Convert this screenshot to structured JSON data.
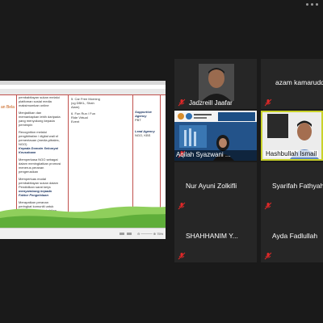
{
  "slide": {
    "header_partial": "an Bela",
    "col2_items": [
      "pembabitayan sukan melalui",
      "platfoman sosial media",
      "maksimumkan online",
      "Menjadikan dan",
      "memantapkan lebih daripada",
      "yang menyokong kepada",
      "pemimpin",
      "Recognition melalui",
      "pengiktirafan / digital wali sf",
      "pementauan (media,pitrales,",
      "NGO)",
      "Kepada Domain Sekunyai",
      "Keusahaan",
      "Memperkasa NGO sebagai",
      "dalam meningkatkan promosi",
      "menerus peranan",
      "pengerusikan",
      "Memperluas modal",
      "pembabitayan sukan dalam",
      "Pendidikan sarat kerja",
      "menyambung kepada",
      "Faktor Pengelolaan",
      "Merapatkan peranan",
      "peringkat komuniti untuk",
      "meningkatkan pembabitan",
      "program sukan dan aktiviti",
      "senaman"
    ],
    "col3_items": [
      "5. Car Free Morning",
      "(cg DBKL, Shah",
      "Alam)",
      "6. Fun Run / Fun",
      "Ride Virtual",
      "Event"
    ],
    "col4_items": [
      "Supportive",
      "Agency",
      "PBT",
      "Lead Agency",
      "NGO, KBS"
    ],
    "zoom_text": "⊖  ─────  ⊕  75%"
  },
  "participants": [
    {
      "name": "Jadzreill Jaafar",
      "muted": true
    },
    {
      "name": "azam kamaruddin",
      "muted": true
    },
    {
      "name": "Aqilah Syazwani ...",
      "muted": true
    },
    {
      "name": "Hashbullah Ismail",
      "muted": false
    },
    {
      "name": "Nur Ayuni Zolkifli",
      "muted": true
    },
    {
      "name": "Syarifah Fathyah",
      "muted": true
    },
    {
      "name": "SHAHHANIM Y...",
      "muted": true
    },
    {
      "name": "Ayda Fadlullah",
      "muted": true
    }
  ],
  "colors": {
    "active_speaker_border": "#c9d22a",
    "muted_mic": "#e02828",
    "tile_bg": "#262626",
    "slide_accent": "#c0504d"
  },
  "icons": {
    "mic_muted": "mic-muted-icon",
    "more_menu": "more-options-icon"
  }
}
